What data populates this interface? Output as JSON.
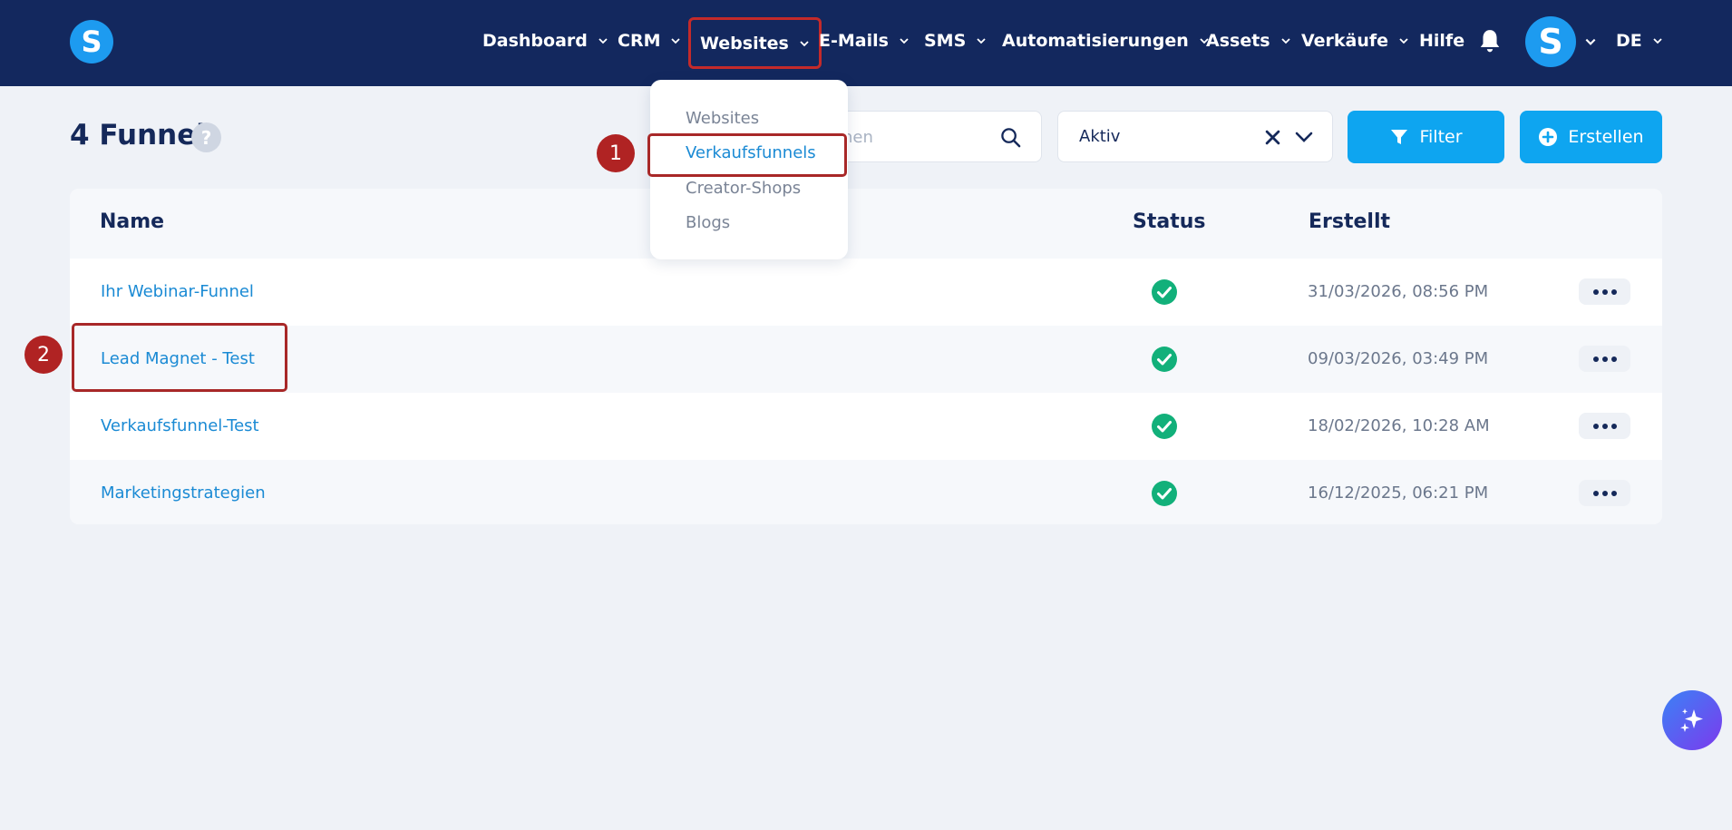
{
  "app": {
    "logo_letter": "S",
    "avatar_letter": "S",
    "language": "DE"
  },
  "nav": {
    "items": [
      {
        "label": "Dashboard"
      },
      {
        "label": "CRM"
      },
      {
        "label": "Websites"
      },
      {
        "label": "E-Mails"
      },
      {
        "label": "SMS"
      },
      {
        "label": "Automatisierungen"
      },
      {
        "label": "Assets"
      },
      {
        "label": "Verkäufe"
      },
      {
        "label": "Hilfe"
      }
    ],
    "icons": [
      "bell-icon",
      "chevron-down-icon"
    ]
  },
  "websites_menu": {
    "items": [
      {
        "label": "Websites"
      },
      {
        "label": "Verkaufsfunnels",
        "active": true
      },
      {
        "label": "Creator-Shops"
      },
      {
        "label": "Blogs"
      }
    ]
  },
  "header": {
    "title": "4 Funnel",
    "help_glyph": "?",
    "search_placeholder": "nen",
    "status_filter_value": "Aktiv",
    "filter_button": "Filter",
    "create_button": "Erstellen"
  },
  "table": {
    "columns": {
      "name": "Name",
      "status": "Status",
      "created": "Erstellt"
    },
    "rows": [
      {
        "name": "Ihr Webinar-Funnel",
        "status": "active",
        "created": "31/03/2026, 08:56 PM"
      },
      {
        "name": "Lead Magnet - Test",
        "status": "active",
        "created": "09/03/2026, 03:49 PM"
      },
      {
        "name": "Verkaufsfunnel-Test",
        "status": "active",
        "created": "18/02/2026, 10:28 AM"
      },
      {
        "name": "Marketingstrategien",
        "status": "active",
        "created": "16/12/2025, 06:21 PM"
      }
    ]
  },
  "annotations": {
    "step1": "1",
    "step2": "2"
  },
  "colors": {
    "nav_bg": "#13285e",
    "accent": "#0ea5f0",
    "link": "#1a8ad4",
    "success": "#12b07a",
    "highlight": "#a82828"
  }
}
